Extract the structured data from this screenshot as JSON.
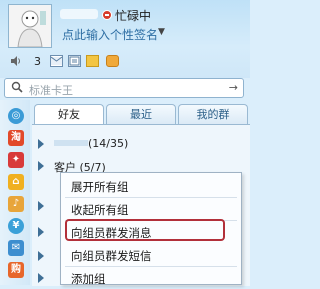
{
  "header": {
    "status_text": "忙碌中",
    "signature": "点此输入个性签名",
    "signature_arrow": "▼",
    "mail_count": "3"
  },
  "search": {
    "placeholder": "标准卡王",
    "icon": "search-icon",
    "go": "→"
  },
  "tabs": [
    {
      "label": "好友"
    },
    {
      "label": "最近"
    },
    {
      "label": "我的群"
    }
  ],
  "groups": [
    {
      "label": "(14/35)"
    },
    {
      "label": "客户 (5/7)"
    }
  ],
  "context_menu": {
    "items": [
      {
        "label": "展开所有组"
      },
      {
        "label": "收起所有组"
      },
      {
        "label": "向组员群发消息"
      },
      {
        "label": "向组员群发短信"
      },
      {
        "label": "添加组"
      }
    ]
  },
  "colors": {
    "accent": "#2f6fa4",
    "busy_red": "#d63b2b",
    "highlight": "#b2303a"
  }
}
